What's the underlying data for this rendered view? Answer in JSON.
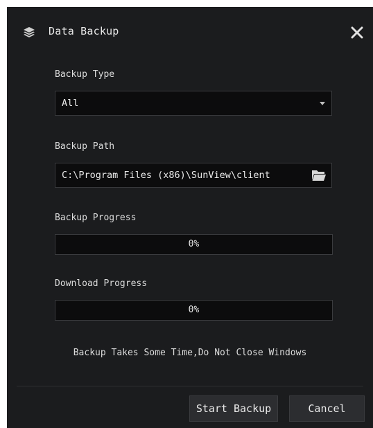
{
  "dialog": {
    "title": "Data Backup",
    "title_icon": "layers-icon",
    "close_icon": "close-icon"
  },
  "backup_type": {
    "label": "Backup Type",
    "value": "All"
  },
  "backup_path": {
    "label": "Backup Path",
    "value": "C:\\Program Files (x86)\\SunView\\client",
    "browse_icon": "folder-icon"
  },
  "backup_progress": {
    "label": "Backup Progress",
    "text": "0%",
    "value": 0
  },
  "download_progress": {
    "label": "Download Progress",
    "text": "0%",
    "value": 0
  },
  "notice": "Backup Takes Some Time,Do Not Close Windows",
  "buttons": {
    "start": "Start Backup",
    "cancel": "Cancel"
  },
  "colors": {
    "background": "#1b1c1e",
    "field": "#0c0c0d",
    "button": "#2c2d30",
    "text": "#e6e6e6"
  }
}
